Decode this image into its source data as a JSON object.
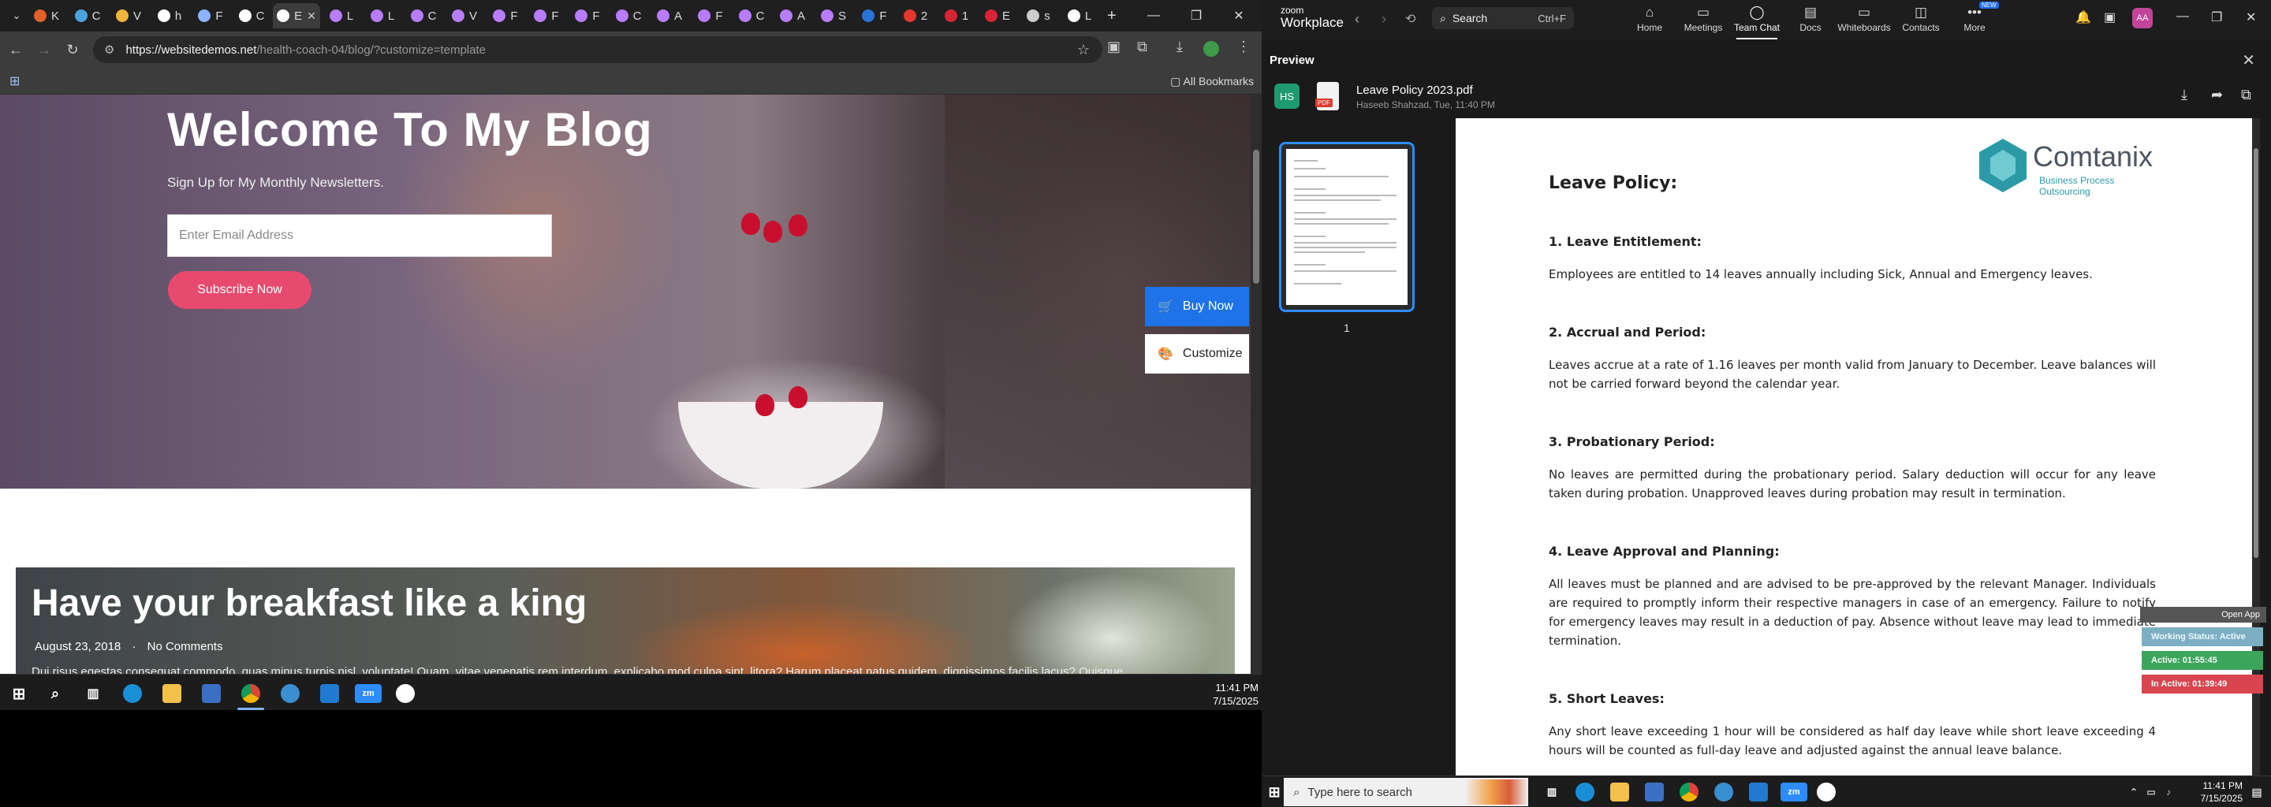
{
  "browser": {
    "url_host": "https://websitedemos.net",
    "url_path": "/health-coach-04/blog/?customize=template",
    "all_bookmarks": "All Bookmarks",
    "tabs": [
      {
        "letter": "K",
        "color": "#e0622a"
      },
      {
        "letter": "C",
        "color": "#4aa3df"
      },
      {
        "letter": "V",
        "color": "#f0b43c"
      },
      {
        "letter": "h",
        "color": "#ffffff"
      },
      {
        "letter": "F",
        "color": "#8bb3ff"
      },
      {
        "letter": "C",
        "color": "#ffffff"
      },
      {
        "letter": "E",
        "color": "#ffffff",
        "active": true
      },
      {
        "letter": "L",
        "color": "#b77cff"
      },
      {
        "letter": "L",
        "color": "#b77cff"
      },
      {
        "letter": "C",
        "color": "#b77cff"
      },
      {
        "letter": "V",
        "color": "#b77cff"
      },
      {
        "letter": "F",
        "color": "#b77cff"
      },
      {
        "letter": "F",
        "color": "#b77cff"
      },
      {
        "letter": "F",
        "color": "#b77cff"
      },
      {
        "letter": "C",
        "color": "#b77cff"
      },
      {
        "letter": "A",
        "color": "#b77cff"
      },
      {
        "letter": "F",
        "color": "#b77cff"
      },
      {
        "letter": "C",
        "color": "#b77cff"
      },
      {
        "letter": "A",
        "color": "#b77cff"
      },
      {
        "letter": "S",
        "color": "#b77cff"
      },
      {
        "letter": "F",
        "color": "#2a73d9"
      },
      {
        "letter": "2",
        "color": "#e2382f"
      },
      {
        "letter": "1",
        "color": "#d82434"
      },
      {
        "letter": "E",
        "color": "#d82434"
      },
      {
        "letter": "s",
        "color": "#cccccc"
      },
      {
        "letter": "L",
        "color": "#ffffff"
      }
    ]
  },
  "webpage": {
    "hero_title": "Welcome To My Blog",
    "hero_subtitle": "Sign Up for My Monthly Newsletters.",
    "email_placeholder": "Enter Email Address",
    "subscribe_label": "Subscribe Now",
    "buy_now_label": "Buy Now",
    "customize_label": "Customize",
    "post_title": "Have your breakfast like a king",
    "post_date": "August 23, 2018",
    "post_comments": "No Comments",
    "post_excerpt": "Dui risus egestas consequat commodo, quas minus turpis nisl, voluptate! Quam, vitae venenatis rem interdum, explicabo mod culpa sint, litora? Harum placeat natus quidem, dignissimos facilis lacus? Quisque"
  },
  "left_taskbar": {
    "time": "11:41 PM",
    "date": "7/15/2025",
    "zoom_label": "zm"
  },
  "zoom": {
    "brand_small": "zoom",
    "brand_big": "Workplace",
    "search_label": "Search",
    "search_shortcut": "Ctrl+F",
    "nav": [
      {
        "label": "Home",
        "icon": "⌂"
      },
      {
        "label": "Meetings",
        "icon": "▭"
      },
      {
        "label": "Team Chat",
        "icon": "◯",
        "active": true
      },
      {
        "label": "Docs",
        "icon": "▤"
      },
      {
        "label": "Whiteboards",
        "icon": "▭"
      },
      {
        "label": "Contacts",
        "icon": "◫"
      },
      {
        "label": "More",
        "icon": "•••",
        "badge": "NEW"
      }
    ],
    "avatar_initials": "AA",
    "preview_title": "Preview",
    "sender_initials": "HS",
    "file_name": "Leave Policy 2023.pdf",
    "file_meta": "Haseeb Shahzad, Tue, 11:40 PM",
    "pdf_badge": "PDF",
    "thumb_page_number": "1"
  },
  "document": {
    "logo_name": "Comtanix",
    "logo_tagline": "Business Process Outsourcing",
    "title": "Leave Policy:",
    "sections": [
      {
        "heading": "1. Leave Entitlement:",
        "body": "Employees are entitled to 14 leaves annually including Sick, Annual and Emergency leaves."
      },
      {
        "heading": "2. Accrual and Period:",
        "body": "Leaves accrue at a rate of 1.16 leaves per month valid from January to December. Leave balances will not be carried forward beyond the calendar year."
      },
      {
        "heading": "3. Probationary Period:",
        "body": "No leaves are permitted during the probationary period. Salary deduction will occur for any leave taken during probation. Unapproved leaves during probation may result in termination."
      },
      {
        "heading": "4. Leave Approval and Planning:",
        "body": "All leaves must be planned and are advised to be pre-approved by the relevant Manager. Individuals are required to promptly inform their respective managers in case of an emergency. Failure to notify for emergency leaves may result in a deduction of pay. Absence without leave may lead to immediate termination."
      },
      {
        "heading": "5. Short Leaves:",
        "body": "Any short leave exceeding 1 hour will be considered as half day leave while short leave exceeding 4 hours will be counted as full-day leave and adjusted against the annual leave balance."
      }
    ]
  },
  "status_widget": {
    "open_app": "Open App",
    "working_status": "Working Status: Active",
    "active_time": "Active: 01:55:45",
    "inactive_time": "In Active: 01:39:49"
  },
  "right_taskbar": {
    "search_placeholder": "Type here to search",
    "time": "11:41 PM",
    "date": "7/15/2025",
    "zoom_label": "zm"
  }
}
